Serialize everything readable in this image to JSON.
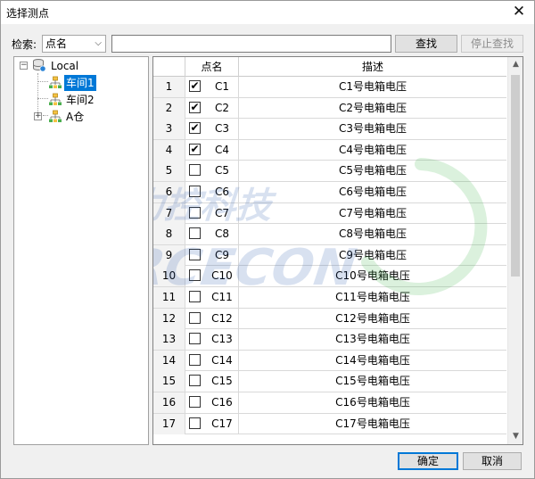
{
  "window": {
    "title": "选择测点",
    "close_glyph": "✕"
  },
  "toolbar": {
    "search_label": "检索:",
    "field_select": "点名",
    "field_select_arrow": "⌵",
    "search_value": "",
    "search_button": "查找",
    "stop_button": "停止查找"
  },
  "tree": {
    "root": {
      "label": "Local",
      "expander": "−"
    },
    "children": [
      {
        "label": "车间1",
        "selected": true
      },
      {
        "label": "车间2",
        "selected": false
      },
      {
        "label": "A仓",
        "expander": "+",
        "selected": false
      }
    ]
  },
  "grid": {
    "columns": [
      "",
      "点名",
      "描述"
    ],
    "rows": [
      {
        "index": "1",
        "checked": true,
        "name": "C1",
        "desc": "C1号电箱电压"
      },
      {
        "index": "2",
        "checked": true,
        "name": "C2",
        "desc": "C2号电箱电压"
      },
      {
        "index": "3",
        "checked": true,
        "name": "C3",
        "desc": "C3号电箱电压"
      },
      {
        "index": "4",
        "checked": true,
        "name": "C4",
        "desc": "C4号电箱电压"
      },
      {
        "index": "5",
        "checked": false,
        "name": "C5",
        "desc": "C5号电箱电压"
      },
      {
        "index": "6",
        "checked": false,
        "name": "C6",
        "desc": "C6号电箱电压"
      },
      {
        "index": "7",
        "checked": false,
        "name": "C7",
        "desc": "C7号电箱电压"
      },
      {
        "index": "8",
        "checked": false,
        "name": "C8",
        "desc": "C8号电箱电压"
      },
      {
        "index": "9",
        "checked": false,
        "name": "C9",
        "desc": "C9号电箱电压"
      },
      {
        "index": "10",
        "checked": false,
        "name": "C10",
        "desc": "C10号电箱电压"
      },
      {
        "index": "11",
        "checked": false,
        "name": "C11",
        "desc": "C11号电箱电压"
      },
      {
        "index": "12",
        "checked": false,
        "name": "C12",
        "desc": "C12号电箱电压"
      },
      {
        "index": "13",
        "checked": false,
        "name": "C13",
        "desc": "C13号电箱电压"
      },
      {
        "index": "14",
        "checked": false,
        "name": "C14",
        "desc": "C14号电箱电压"
      },
      {
        "index": "15",
        "checked": false,
        "name": "C15",
        "desc": "C15号电箱电压"
      },
      {
        "index": "16",
        "checked": false,
        "name": "C16",
        "desc": "C16号电箱电压"
      },
      {
        "index": "17",
        "checked": false,
        "name": "C17",
        "desc": "C17号电箱电压"
      }
    ],
    "check_glyph": "✔",
    "scroll_up_glyph": "▲",
    "scroll_down_glyph": "▼"
  },
  "footer": {
    "ok_button": "确定",
    "cancel_button": "取消"
  },
  "watermark": {
    "text_cn": "力控科技",
    "text_en": "FORCECON"
  },
  "colors": {
    "accent": "#0078d7",
    "watermark_blue": "#2f5fb0",
    "watermark_green": "#3cb44a"
  },
  "icons": {
    "close": "close-icon",
    "database": "database-icon",
    "group": "folder-network-icon"
  }
}
